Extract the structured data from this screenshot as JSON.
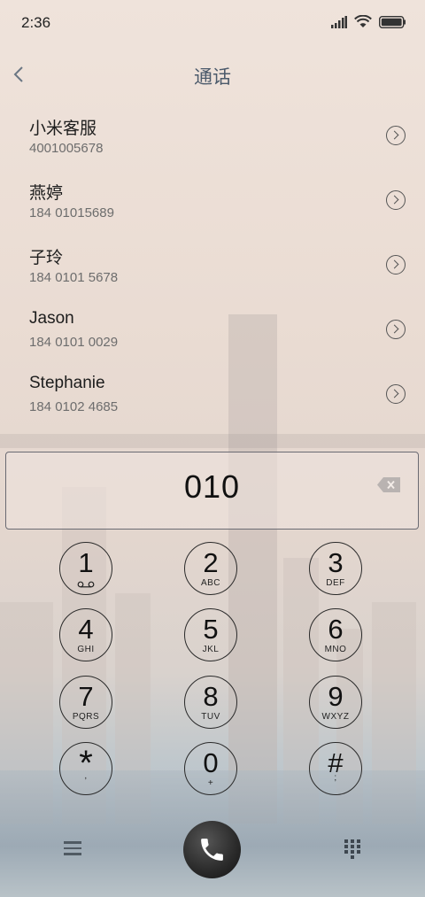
{
  "status": {
    "time": "2:36"
  },
  "header": {
    "title": "通话"
  },
  "contacts": [
    {
      "name": "小米客服",
      "number": "4001005678"
    },
    {
      "name": "燕婷",
      "number": "184 01015689"
    },
    {
      "name": "子玲",
      "number": "184 0101 5678"
    },
    {
      "name": "Jason",
      "number": "184 0101 0029"
    },
    {
      "name": "Stephanie",
      "number": "184 0102 4685"
    }
  ],
  "dialer": {
    "input": "010",
    "keys": [
      {
        "digit": "1",
        "letters": ""
      },
      {
        "digit": "2",
        "letters": "ABC"
      },
      {
        "digit": "3",
        "letters": "DEF"
      },
      {
        "digit": "4",
        "letters": "GHI"
      },
      {
        "digit": "5",
        "letters": "JKL"
      },
      {
        "digit": "6",
        "letters": "MNO"
      },
      {
        "digit": "7",
        "letters": "PQRS"
      },
      {
        "digit": "8",
        "letters": "TUV"
      },
      {
        "digit": "9",
        "letters": "WXYZ"
      },
      {
        "digit": "*",
        "letters": ","
      },
      {
        "digit": "0",
        "letters": "+"
      },
      {
        "digit": "#",
        "letters": ";"
      }
    ]
  },
  "icons": {
    "back": "chevron-left-icon",
    "info": "chevron-right-circle-icon",
    "backspace": "backspace-icon",
    "voicemail": "voicemail-icon",
    "menu": "menu-icon",
    "call": "phone-icon",
    "keypad": "keypad-icon"
  }
}
